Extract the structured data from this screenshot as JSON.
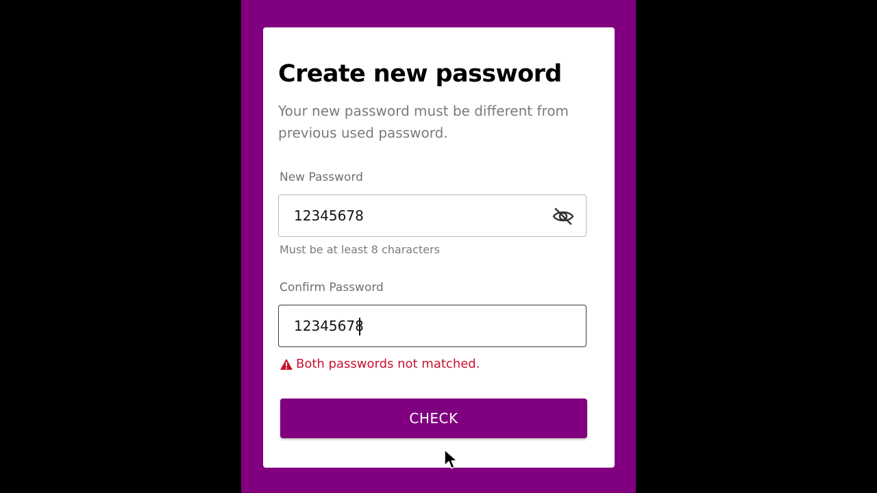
{
  "colors": {
    "accent": "#800080",
    "error": "#c8102e",
    "muted_text": "#7a7a7a"
  },
  "form": {
    "title": "Create new password",
    "subtitle": "Your new password must be different from previous used password.",
    "new_password": {
      "label": "New Password",
      "value": "12345678",
      "hint": "Must be at least 8 characters",
      "visibility_icon": "eye-slash-icon"
    },
    "confirm_password": {
      "label": "Confirm Password",
      "value": "12345678"
    },
    "error": {
      "icon": "warning-icon",
      "message": "Both passwords not matched."
    },
    "submit_label": "CHECK"
  }
}
